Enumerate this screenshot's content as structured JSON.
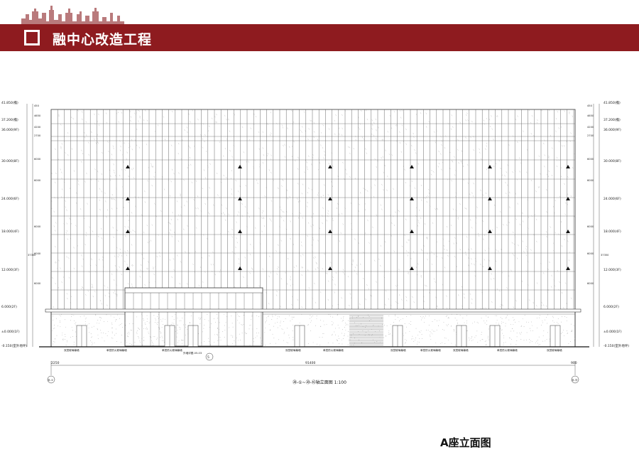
{
  "header": {
    "title": "融中心改造工程",
    "brand_color": "#8e1b1f"
  },
  "drawing": {
    "left_levels": [
      "41.850(檐)",
      "37.200(檐)",
      "36.000(9F)",
      "30.000(8F)",
      "24.000(6F)",
      "18.000(4F)",
      "12.000(3F)",
      "6.000(2F)",
      "±0.000(1F)",
      "-0.150(室外地坪)"
    ],
    "right_levels": [
      "41.850(檐)",
      "37.200(檐)",
      "36.000(9F)",
      "30.000(8F)",
      "24.000(6F)",
      "18.000(4F)",
      "12.000(3F)",
      "6.000(2F)",
      "±0.000(1F)",
      "-0.150(室外地坪)"
    ],
    "left_dims": [
      "450",
      "4650",
      "4200",
      "2700",
      "6000",
      "6000",
      "6000",
      "6000",
      "6000"
    ],
    "right_dims": [
      "450",
      "4650",
      "4200",
      "2700",
      "6000",
      "6000",
      "6000",
      "6000",
      "6000"
    ],
    "overall_height": "37350",
    "bottom_dims": [
      "2250",
      "91400",
      "900"
    ],
    "axis_left": "⑳-①",
    "axis_right": "⑳-⑯",
    "detail_ref": "5",
    "detail_note": "外墙详图-05-03",
    "bottom_tags": [
      "双层玻璃幕墙",
      "单层防火玻璃幕墙",
      "单层防火玻璃幕墙",
      "双层玻璃幕墙",
      "单层防火玻璃幕墙",
      "双层玻璃幕墙",
      "单层防火玻璃幕墙",
      "双层玻璃幕墙",
      "单层防火玻璃幕墙",
      "双层玻璃幕墙"
    ],
    "elevation_title": "⑳-①~⑳-⑯轴立面图 1:100"
  },
  "caption": "A座立面图"
}
